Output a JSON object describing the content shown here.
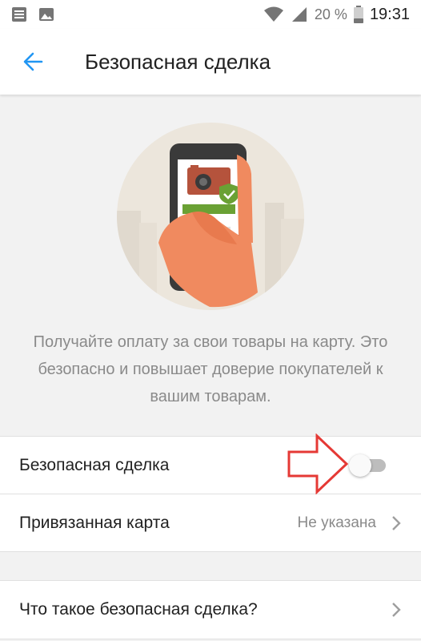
{
  "status_bar": {
    "battery": "20 %",
    "time": "19:31"
  },
  "toolbar": {
    "title": "Безопасная сделка"
  },
  "promo_text": "Получайте оплату за свои товары на карту. Это безопасно и повышает доверие покупателей к вашим товарам.",
  "settings": {
    "safe_deal": {
      "label": "Безопасная сделка",
      "enabled": false
    },
    "linked_card": {
      "label": "Привязанная карта",
      "value": "Не указана"
    },
    "what_is": {
      "label": "Что такое безопасная сделка?"
    }
  },
  "colors": {
    "accent": "#2196f3",
    "annotation_arrow": "#e53935",
    "price_bar": "#6aa134"
  }
}
